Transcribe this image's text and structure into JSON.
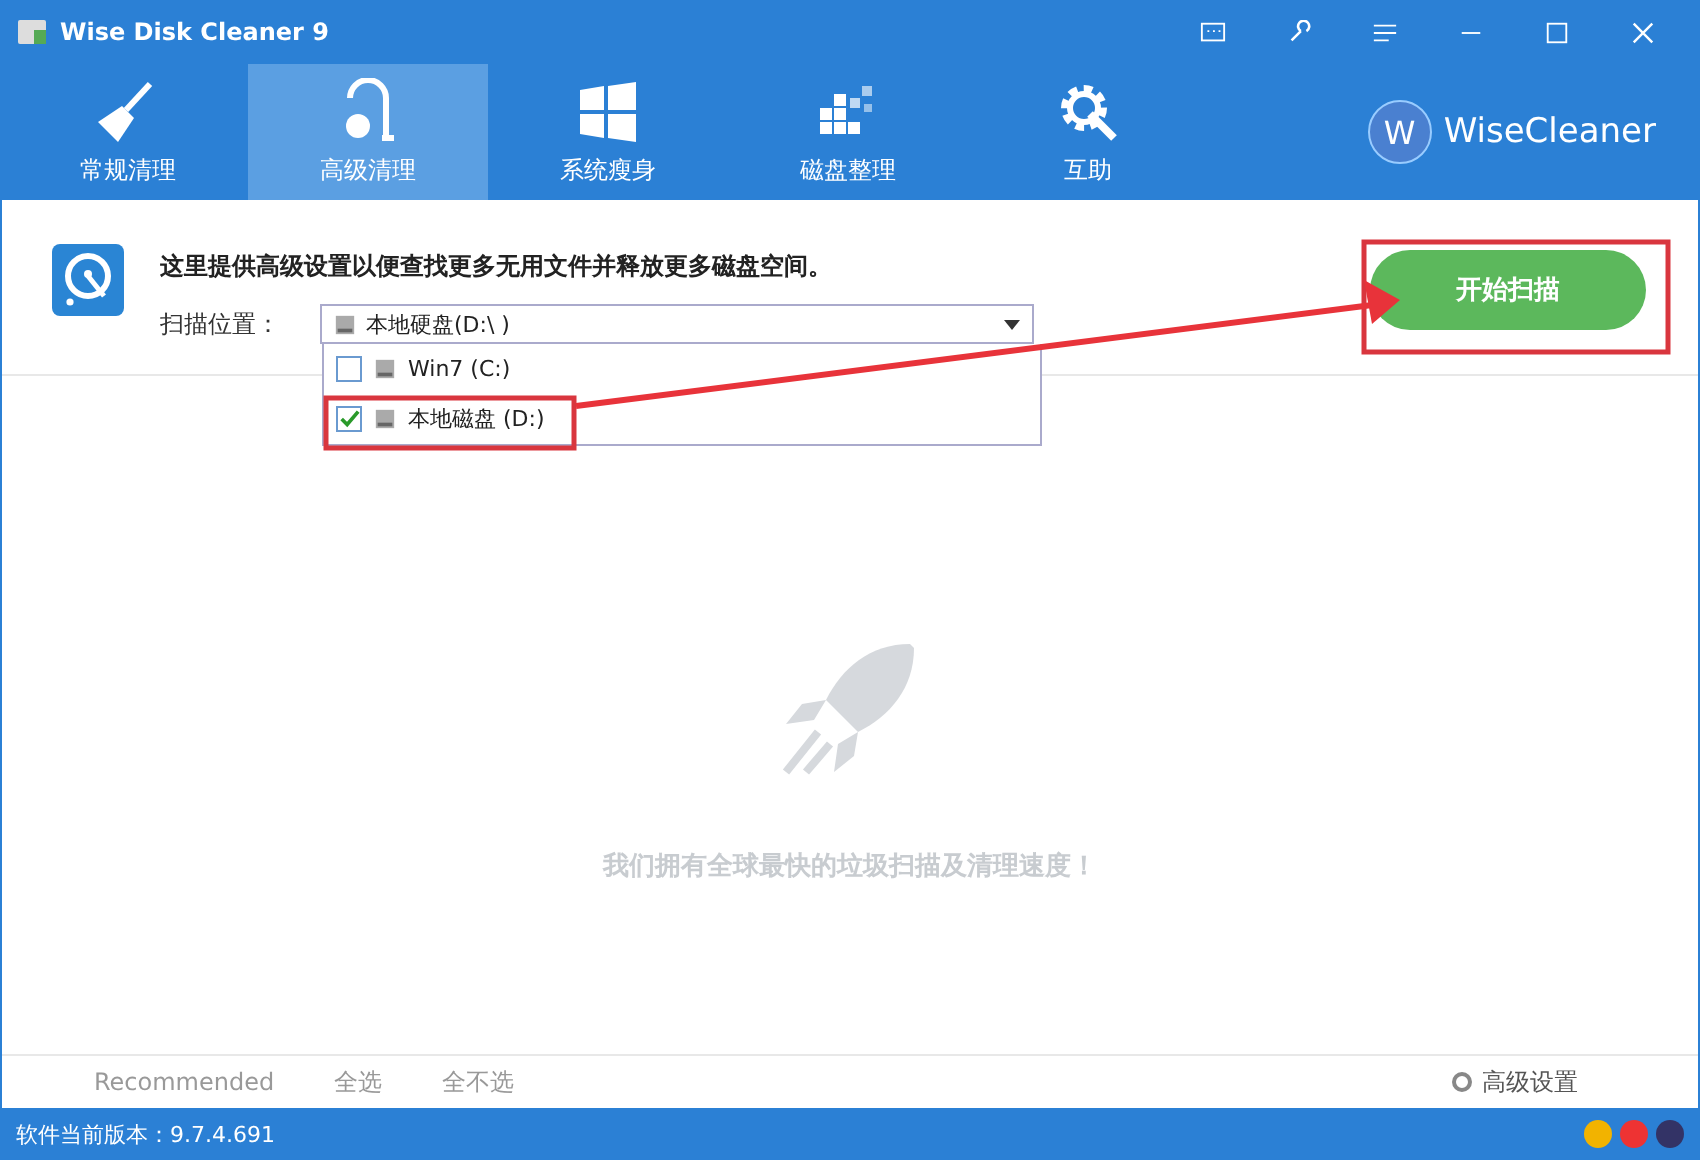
{
  "window": {
    "title": "Wise Disk Cleaner 9"
  },
  "tabs": [
    {
      "label": "常规清理",
      "selected": false
    },
    {
      "label": "高级清理",
      "selected": true
    },
    {
      "label": "系统瘦身",
      "selected": false
    },
    {
      "label": "磁盘整理",
      "selected": false
    },
    {
      "label": "互助",
      "selected": false
    }
  ],
  "brand": {
    "logo_letter": "W",
    "name": "WiseCleaner"
  },
  "intro": {
    "text": "这里提供高级设置以便查找更多无用文件并释放更多磁盘空间。",
    "scan_location_label": "扫描位置：",
    "dropdown_value": "本地硬盘(D:\\ )"
  },
  "drives": [
    {
      "label": "Win7 (C:)",
      "checked": false
    },
    {
      "label": "本地磁盘 (D:)",
      "checked": true
    }
  ],
  "scan_button": "开始扫描",
  "empty_state": {
    "text": "我们拥有全球最快的垃圾扫描及清理速度！"
  },
  "footer_links": [
    "Recommended",
    "全选",
    "全不选"
  ],
  "advanced_settings": "高级设置",
  "status_bar": {
    "version": "软件当前版本：9.7.4.691"
  }
}
